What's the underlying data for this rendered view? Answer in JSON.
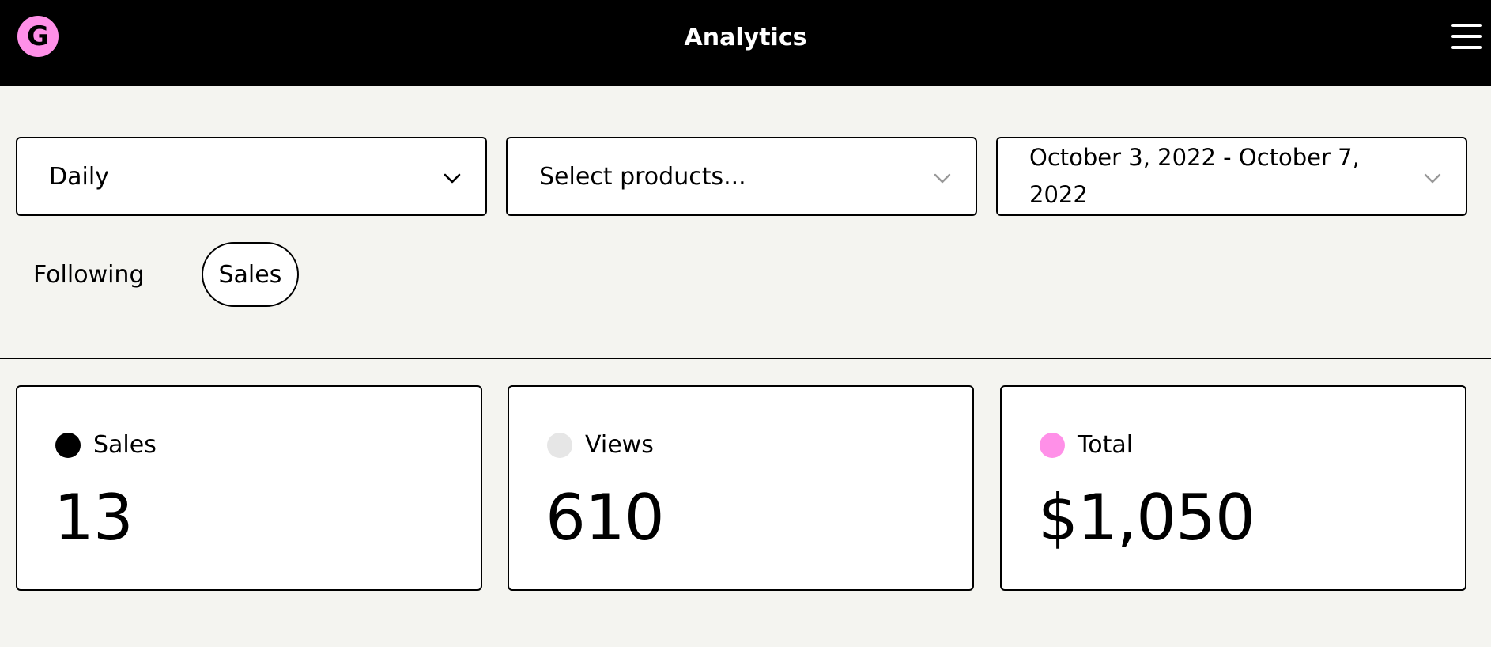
{
  "header": {
    "logo_letter": "G",
    "title": "Analytics"
  },
  "filters": {
    "interval": "Daily",
    "products_placeholder": "Select products...",
    "date_range_line1": "October 3, 2022 - October 7,",
    "date_range_line2": "2022"
  },
  "tabs": [
    {
      "label": "Following",
      "active": false
    },
    {
      "label": "Sales",
      "active": true
    }
  ],
  "cards": [
    {
      "label": "Sales",
      "value": "13",
      "color": "#000000"
    },
    {
      "label": "Views",
      "value": "610",
      "color": "#e6e6e6"
    },
    {
      "label": "Total",
      "value": "$1,050",
      "color": "#ff90e8"
    }
  ],
  "colors": {
    "brand_pink": "#ff90e8",
    "background": "#f4f4f0",
    "header_bg": "#000000"
  },
  "icons": {
    "menu": "hamburger-icon",
    "dropdown": "chevron-down-icon"
  }
}
